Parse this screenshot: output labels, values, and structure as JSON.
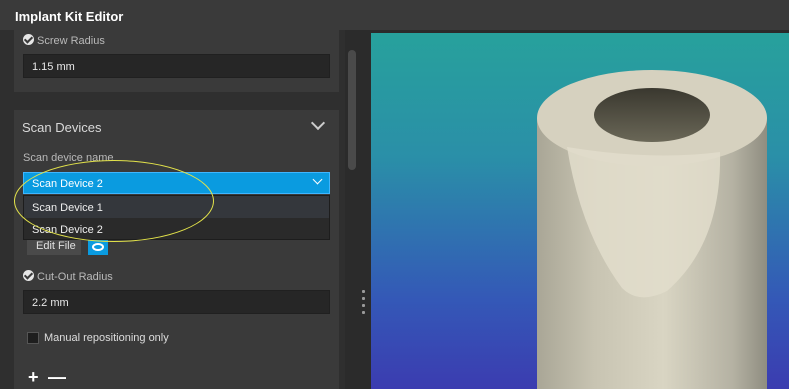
{
  "window": {
    "title": "Implant Kit Editor"
  },
  "screw_radius": {
    "label": "Screw Radius",
    "value": "1.15 mm"
  },
  "scan_devices": {
    "title": "Scan Devices",
    "field_label": "Scan device name",
    "selected": "Scan Device 2",
    "options": [
      "Scan Device 1",
      "Scan Device 2"
    ],
    "edit_file_label": "Edit File"
  },
  "cut_out_radius": {
    "label": "Cut-Out Radius",
    "value": "2.2 mm"
  },
  "manual_repositioning": {
    "label": "Manual repositioning only",
    "checked": false
  },
  "buttons": {
    "add": "+",
    "remove": "—"
  },
  "icons": [
    "check-circle-icon",
    "chevron-down-icon",
    "eye-icon",
    "plus-icon",
    "minus-icon",
    "drag-handle-icon"
  ],
  "colors": {
    "accent": "#0a9be0",
    "annotation": "#e2e24a",
    "viewport_top": "#27a19c",
    "viewport_bottom": "#3b3cb0",
    "model": "#d8d3c0"
  }
}
